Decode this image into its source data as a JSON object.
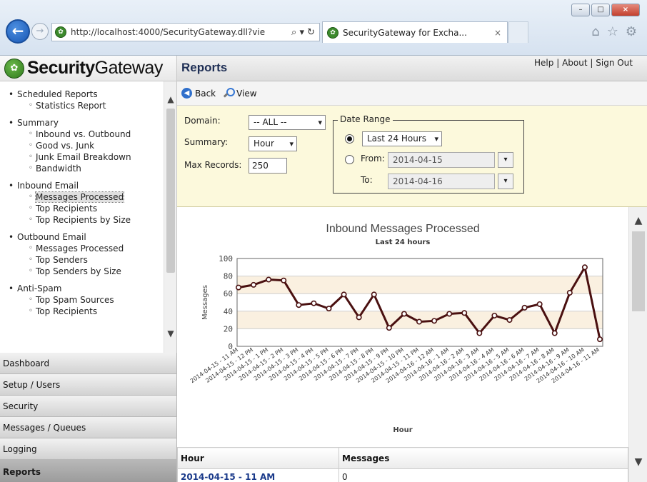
{
  "browser": {
    "url": "http://localhost:4000/SecurityGateway.dll?vie",
    "tab_title": "SecurityGateway for Excha...",
    "tab_close": "×",
    "address_tools": "⌕ ▾ ↻",
    "window_buttons": {
      "minimize": "–",
      "maximize": "□",
      "close": "×"
    },
    "back_glyph": "←",
    "forward_glyph": "→",
    "toolbar_icons": {
      "home": "⌂",
      "favorites": "☆",
      "settings": "⚙"
    }
  },
  "app": {
    "brand_bold": "Security",
    "brand_light": "Gateway",
    "page_title": "Reports",
    "links": {
      "help": "Help",
      "about": "About",
      "signout": "Sign Out",
      "sep": "|"
    }
  },
  "sidebar": {
    "groups": [
      {
        "label": "Scheduled Reports",
        "items": [
          "Statistics Report"
        ]
      },
      {
        "label": "Summary",
        "items": [
          "Inbound vs. Outbound",
          "Good vs. Junk",
          "Junk Email Breakdown",
          "Bandwidth"
        ]
      },
      {
        "label": "Inbound Email",
        "items": [
          "Messages Processed",
          "Top Recipients",
          "Top Recipients by Size"
        ]
      },
      {
        "label": "Outbound Email",
        "items": [
          "Messages Processed",
          "Top Senders",
          "Top Senders by Size"
        ]
      },
      {
        "label": "Anti-Spam",
        "items": [
          "Top Spam Sources",
          "Top Recipients"
        ]
      }
    ],
    "selected": "Inbound Email/Messages Processed",
    "nav": [
      "Dashboard",
      "Setup / Users",
      "Security",
      "Messages / Queues",
      "Logging",
      "Reports"
    ],
    "active_nav": "Reports"
  },
  "toolbar": {
    "back": "Back",
    "view": "View"
  },
  "filters": {
    "domain_label": "Domain:",
    "domain_value": "-- ALL --",
    "summary_label": "Summary:",
    "summary_value": "Hour",
    "max_label": "Max Records:",
    "max_value": "250",
    "date_range_legend": "Date Range",
    "range_option": "Last 24 Hours",
    "from_label": "From:",
    "from_value": "2014-04-15",
    "to_label": "To:",
    "to_value": "2014-04-16",
    "caret": "▾"
  },
  "chart_data": {
    "type": "line",
    "title": "Inbound Messages Processed",
    "subtitle": "Last 24 hours",
    "xlabel": "Hour",
    "ylabel": "Messages",
    "ylim": [
      0,
      100
    ],
    "yticks": [
      0,
      20,
      40,
      60,
      80,
      100
    ],
    "grid": true,
    "colors": {
      "line": "#4a1010",
      "band": "#faf0e0",
      "grid": "#cfcfcf"
    },
    "categories": [
      "2014-04-15 - 11 AM",
      "2014-04-15 - 12 PM",
      "2014-04-15 - 1 PM",
      "2014-04-15 - 2 PM",
      "2014-04-15 - 3 PM",
      "2014-04-15 - 4 PM",
      "2014-04-15 - 5 PM",
      "2014-04-15 - 6 PM",
      "2014-04-15 - 7 PM",
      "2014-04-15 - 8 PM",
      "2014-04-15 - 9 PM",
      "2014-04-15 - 10 PM",
      "2014-04-15 - 11 PM",
      "2014-04-16 - 12 AM",
      "2014-04-16 - 1 AM",
      "2014-04-16 - 2 AM",
      "2014-04-16 - 3 AM",
      "2014-04-16 - 4 AM",
      "2014-04-16 - 5 AM",
      "2014-04-16 - 6 AM",
      "2014-04-16 - 7 AM",
      "2014-04-16 - 8 AM",
      "2014-04-16 - 9 AM",
      "2014-04-16 - 10 AM",
      "2014-04-16 - 11 AM"
    ],
    "values": [
      67,
      70,
      76,
      75,
      47,
      49,
      43,
      59,
      33,
      59,
      21,
      37,
      28,
      29,
      37,
      38,
      15,
      35,
      30,
      44,
      48,
      15,
      61,
      90,
      8
    ]
  },
  "table": {
    "headers": [
      "Hour",
      "Messages"
    ],
    "rows": [
      [
        "2014-04-15 - 11 AM",
        "0"
      ]
    ]
  },
  "scroll": {
    "up": "▲",
    "down": "▼"
  }
}
